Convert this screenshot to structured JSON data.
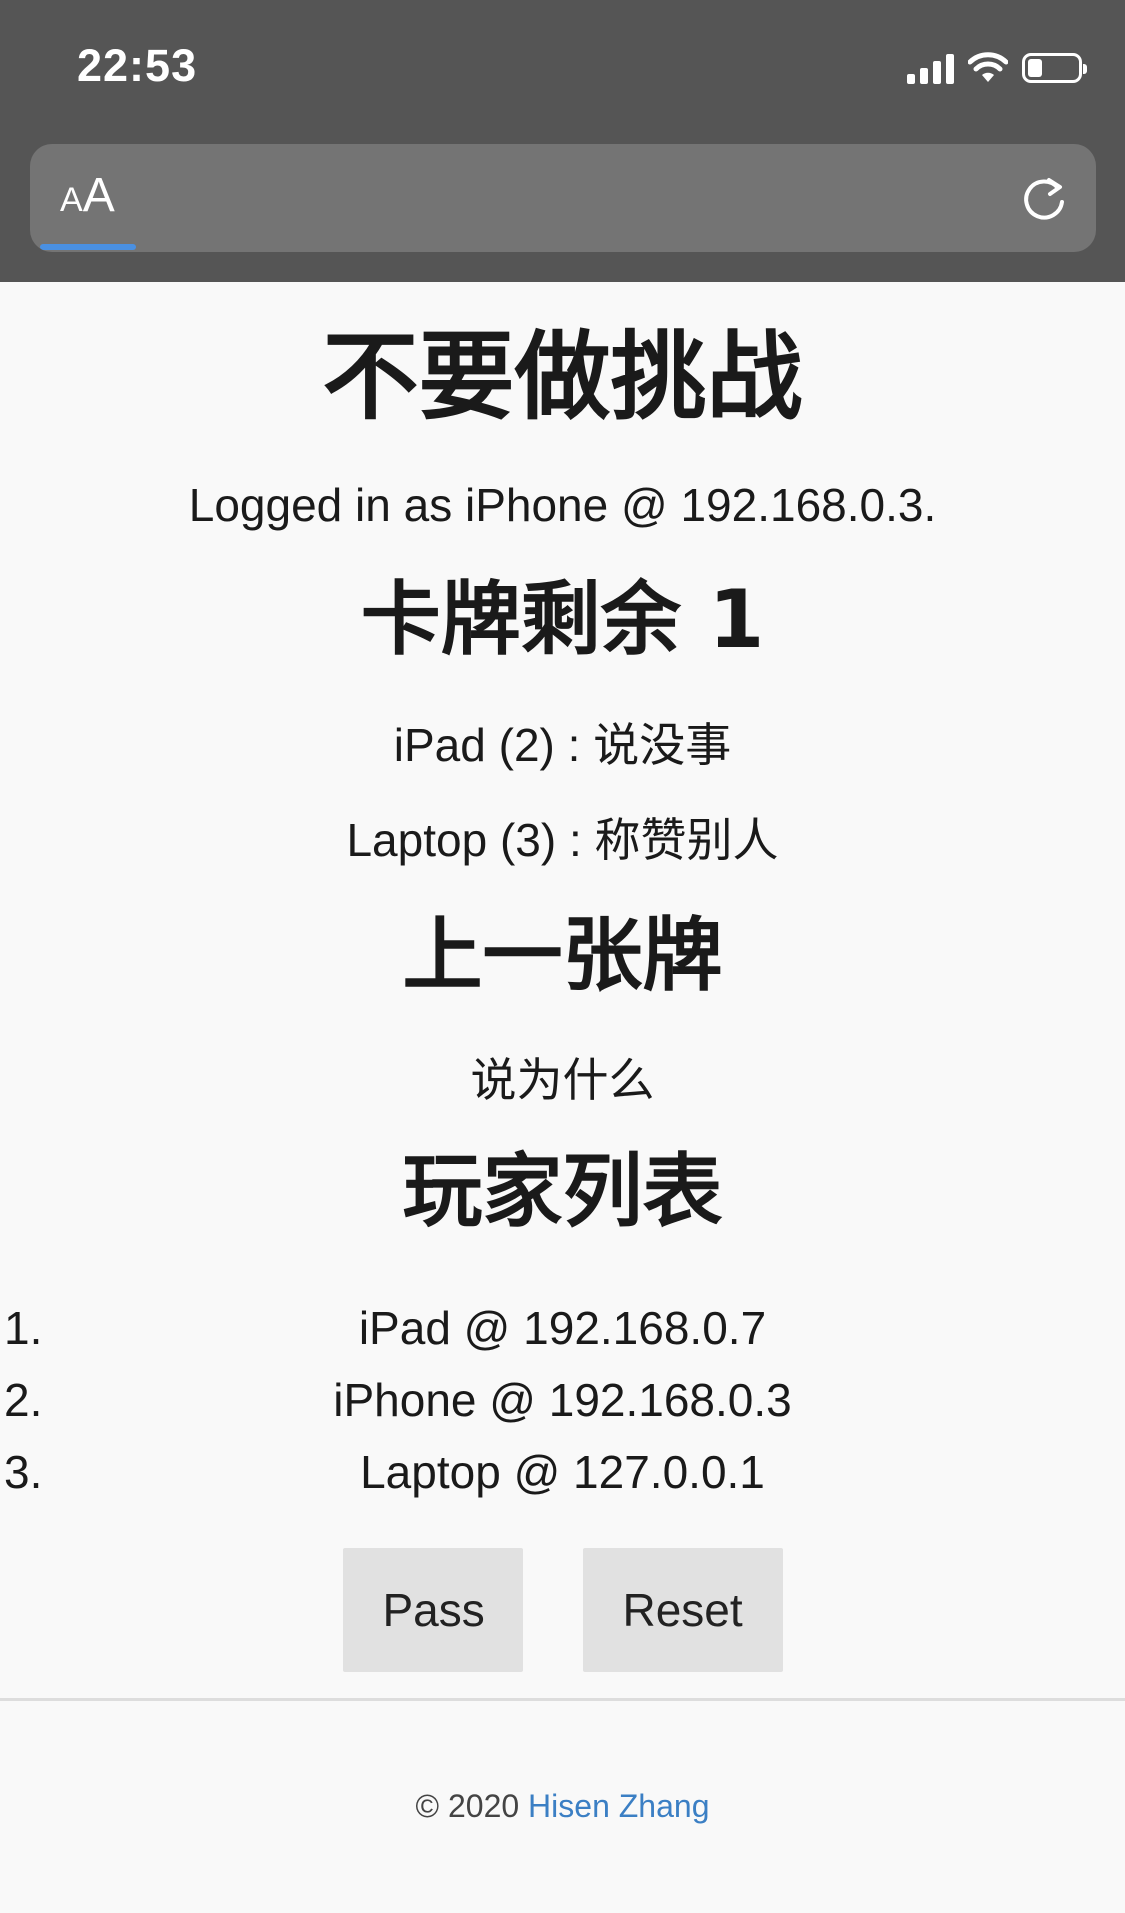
{
  "status_bar": {
    "time": "22:53"
  },
  "address_bar": {
    "text_size_button": "AA",
    "progress_percent": 9
  },
  "page": {
    "title": "不要做挑战",
    "logged_in": "Logged in as iPhone @ 192.168.0.3.",
    "cards_heading": "卡牌剩余 1",
    "player_cards": [
      "iPad (2) : 说没事",
      "Laptop (3) : 称赞别人"
    ],
    "last_card_heading": "上一张牌",
    "last_card": "说为什么",
    "players_heading": "玩家列表",
    "players": [
      {
        "num": "1.",
        "label": "iPad @ 192.168.0.7"
      },
      {
        "num": "2.",
        "label": "iPhone @ 192.168.0.3"
      },
      {
        "num": "3.",
        "label": "Laptop @ 127.0.0.1"
      }
    ],
    "buttons": {
      "pass": "Pass",
      "reset": "Reset"
    }
  },
  "footer": {
    "copyright": "© 2020",
    "author": "Hisen Zhang"
  }
}
